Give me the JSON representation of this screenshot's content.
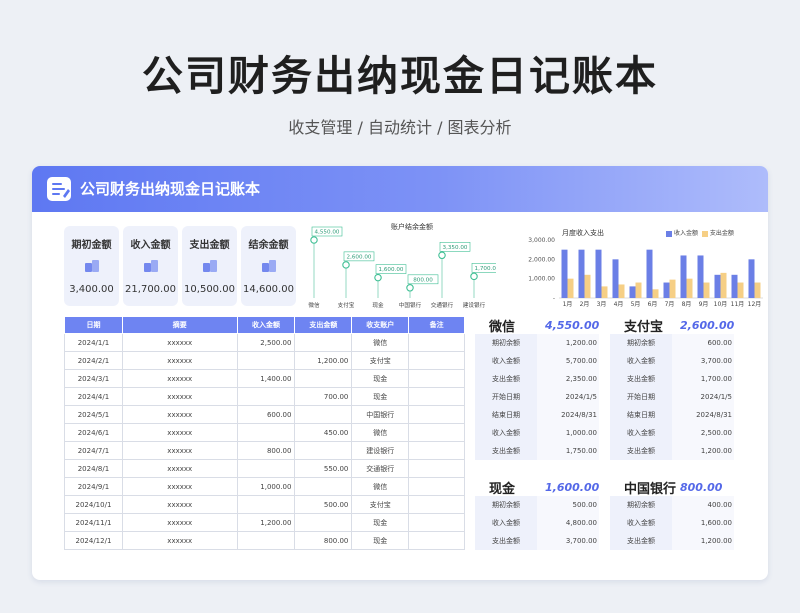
{
  "page": {
    "title": "公司财务出纳现金日记账本",
    "subtitle": "收支管理 / 自动统计 / 图表分析"
  },
  "card": {
    "title": "公司财务出纳现金日记账本"
  },
  "kpis": [
    {
      "label": "期初金额",
      "value": "3,400.00"
    },
    {
      "label": "收入金额",
      "value": "21,700.00"
    },
    {
      "label": "支出金额",
      "value": "10,500.00"
    },
    {
      "label": "结余金额",
      "value": "14,600.00"
    }
  ],
  "balance_chart": {
    "title": "账户结余金额",
    "accounts": [
      "微信",
      "支付宝",
      "现金",
      "中国银行",
      "交通银行",
      "建设银行"
    ],
    "values": [
      4550,
      2600,
      1600,
      800,
      3350,
      1700
    ],
    "labels": [
      "4,550.00",
      "2,600.00",
      "1,600.00",
      "800.00",
      "3,350.00",
      "1,700.00"
    ]
  },
  "chart_data": {
    "type": "bar",
    "title": "月度收入支出",
    "categories": [
      "1月",
      "2月",
      "3月",
      "4月",
      "5月",
      "6月",
      "7月",
      "8月",
      "9月",
      "10月",
      "11月",
      "12月"
    ],
    "series": [
      {
        "name": "收入金额",
        "values": [
          2500,
          2500,
          2500,
          2000,
          600,
          2500,
          800,
          2200,
          2200,
          1200,
          1200,
          2000
        ]
      },
      {
        "name": "支出金额",
        "values": [
          1000,
          1200,
          600,
          700,
          800,
          450,
          950,
          1000,
          800,
          1300,
          800,
          800
        ]
      }
    ],
    "yticks": [
      "3,000.00",
      "2,000.00",
      "1,000.00",
      "-"
    ],
    "ylim": [
      0,
      3000
    ],
    "legend": "top-right",
    "colors": {
      "income": "#6b7fe6",
      "expense": "#f6cf85"
    }
  },
  "ledger": {
    "headers": [
      "日期",
      "摘要",
      "收入金额",
      "支出金额",
      "收支账户",
      "备注"
    ],
    "rows": [
      [
        "2024/1/1",
        "xxxxxx",
        "2,500.00",
        "",
        "微信",
        ""
      ],
      [
        "2024/2/1",
        "xxxxxx",
        "",
        "1,200.00",
        "支付宝",
        ""
      ],
      [
        "2024/3/1",
        "xxxxxx",
        "1,400.00",
        "",
        "现金",
        ""
      ],
      [
        "2024/4/1",
        "xxxxxx",
        "",
        "700.00",
        "现金",
        ""
      ],
      [
        "2024/5/1",
        "xxxxxx",
        "600.00",
        "",
        "中国银行",
        ""
      ],
      [
        "2024/6/1",
        "xxxxxx",
        "",
        "450.00",
        "微信",
        ""
      ],
      [
        "2024/7/1",
        "xxxxxx",
        "800.00",
        "",
        "建设银行",
        ""
      ],
      [
        "2024/8/1",
        "xxxxxx",
        "",
        "550.00",
        "交通银行",
        ""
      ],
      [
        "2024/9/1",
        "xxxxxx",
        "1,000.00",
        "",
        "微信",
        ""
      ],
      [
        "2024/10/1",
        "xxxxxx",
        "",
        "500.00",
        "支付宝",
        ""
      ],
      [
        "2024/11/1",
        "xxxxxx",
        "1,200.00",
        "",
        "现金",
        ""
      ],
      [
        "2024/12/1",
        "xxxxxx",
        "",
        "800.00",
        "现金",
        ""
      ]
    ]
  },
  "accounts": {
    "wechat": {
      "name": "微信",
      "amount": "4,550.00",
      "rows": [
        [
          "期初余额",
          "1,200.00"
        ],
        [
          "收入金额",
          "5,700.00"
        ],
        [
          "支出金额",
          "2,350.00"
        ],
        [
          "开始日期",
          "2024/1/5"
        ],
        [
          "结束日期",
          "2024/8/31"
        ],
        [
          "收入金额",
          "1,000.00"
        ],
        [
          "支出金额",
          "1,750.00"
        ]
      ]
    },
    "alipay": {
      "name": "支付宝",
      "amount": "2,600.00",
      "rows": [
        [
          "期初余额",
          "600.00"
        ],
        [
          "收入金额",
          "3,700.00"
        ],
        [
          "支出金额",
          "1,700.00"
        ],
        [
          "开始日期",
          "2024/1/5"
        ],
        [
          "结束日期",
          "2024/8/31"
        ],
        [
          "收入金额",
          "2,500.00"
        ],
        [
          "支出金额",
          "1,200.00"
        ]
      ]
    },
    "cash": {
      "name": "现金",
      "amount": "1,600.00",
      "rows": [
        [
          "期初余额",
          "500.00"
        ],
        [
          "收入金额",
          "4,800.00"
        ],
        [
          "支出金额",
          "3,700.00"
        ]
      ]
    },
    "boc": {
      "name": "中国银行",
      "amount": "800.00",
      "rows": [
        [
          "期初余额",
          "400.00"
        ],
        [
          "收入金额",
          "1,600.00"
        ],
        [
          "支出金额",
          "1,200.00"
        ]
      ]
    }
  }
}
